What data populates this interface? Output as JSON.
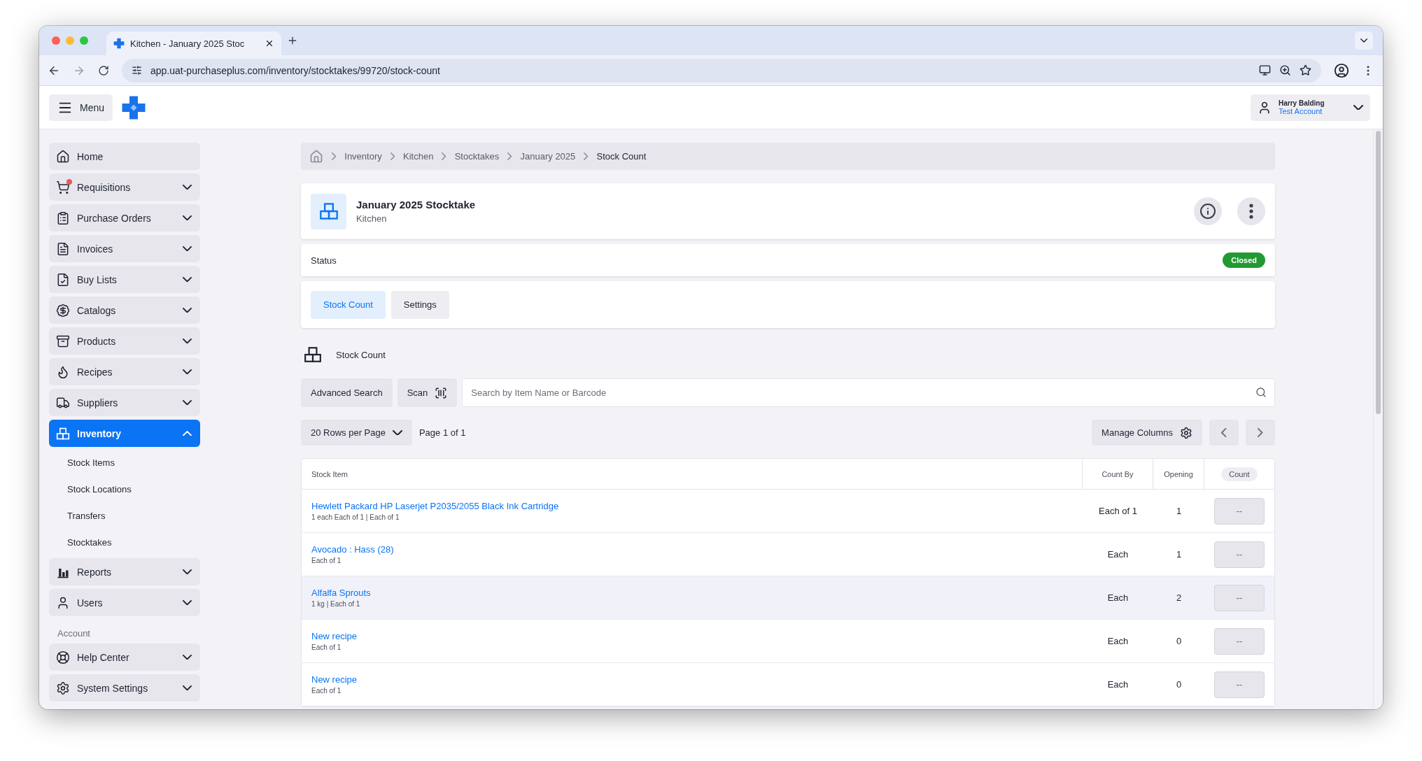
{
  "browser": {
    "tab_title": "Kitchen - January 2025 Stoc",
    "url": "app.uat-purchaseplus.com/inventory/stocktakes/99720/stock-count"
  },
  "header": {
    "menu_label": "Menu",
    "user_name": "Harry Balding",
    "account_name": "Test Account"
  },
  "sidebar": {
    "items": [
      {
        "label": "Home",
        "kind": "link",
        "selected": false
      },
      {
        "label": "Requisitions",
        "kind": "group",
        "selected": false,
        "expanded": false
      },
      {
        "label": "Purchase Orders",
        "kind": "group",
        "selected": false,
        "expanded": false
      },
      {
        "label": "Invoices",
        "kind": "group",
        "selected": false,
        "expanded": false
      },
      {
        "label": "Buy Lists",
        "kind": "group",
        "selected": false,
        "expanded": false
      },
      {
        "label": "Catalogs",
        "kind": "group",
        "selected": false,
        "expanded": false
      },
      {
        "label": "Products",
        "kind": "group",
        "selected": false,
        "expanded": false
      },
      {
        "label": "Recipes",
        "kind": "group",
        "selected": false,
        "expanded": false
      },
      {
        "label": "Suppliers",
        "kind": "group",
        "selected": false,
        "expanded": false
      },
      {
        "label": "Inventory",
        "kind": "group",
        "selected": true,
        "expanded": true,
        "children": [
          {
            "label": "Stock Items"
          },
          {
            "label": "Stock Locations"
          },
          {
            "label": "Transfers"
          },
          {
            "label": "Stocktakes"
          }
        ]
      },
      {
        "label": "Reports",
        "kind": "group",
        "selected": false,
        "expanded": false
      },
      {
        "label": "Users",
        "kind": "group",
        "selected": false,
        "expanded": false
      }
    ],
    "section_heading": "Account",
    "account_items": [
      {
        "label": "Help Center",
        "kind": "group",
        "selected": false,
        "expanded": false
      },
      {
        "label": "System Settings",
        "kind": "group",
        "selected": false,
        "expanded": false
      }
    ]
  },
  "breadcrumb": [
    "Inventory",
    "Kitchen",
    "Stocktakes",
    "January 2025",
    "Stock Count"
  ],
  "stocktake": {
    "title": "January 2025 Stocktake",
    "subtitle": "Kitchen"
  },
  "status": {
    "label": "Status",
    "badge": "Closed"
  },
  "tabs": [
    {
      "label": "Stock Count",
      "selected": true
    },
    {
      "label": "Settings",
      "selected": false
    }
  ],
  "section_title": "Stock Count",
  "toolbar": {
    "advanced_search": "Advanced Search",
    "scan": "Scan",
    "search_placeholder": "Search by Item Name or Barcode"
  },
  "pagination": {
    "rows_per_page": "20 Rows per Page",
    "page_info": "Page 1 of 1",
    "manage_columns": "Manage Columns"
  },
  "table": {
    "columns": [
      "Stock Item",
      "Count By",
      "Opening",
      "Count"
    ],
    "rows": [
      {
        "name": "Hewlett Packard HP Laserjet P2035/2055 Black Ink Cartridge",
        "detail": "1 each Each of 1 | Each of 1",
        "count_by": "Each of 1",
        "opening": "1",
        "count": "--",
        "highlighted": false
      },
      {
        "name": "Avocado : Hass (28)",
        "detail": "Each of 1",
        "count_by": "Each",
        "opening": "1",
        "count": "--",
        "highlighted": false
      },
      {
        "name": "Alfalfa Sprouts",
        "detail": "1 kg | Each of 1",
        "count_by": "Each",
        "opening": "2",
        "count": "--",
        "highlighted": true
      },
      {
        "name": "New recipe",
        "detail": "Each of 1",
        "count_by": "Each",
        "opening": "0",
        "count": "--",
        "highlighted": false
      },
      {
        "name": "New recipe",
        "detail": "Each of 1",
        "count_by": "Each",
        "opening": "0",
        "count": "--",
        "highlighted": false
      }
    ]
  }
}
